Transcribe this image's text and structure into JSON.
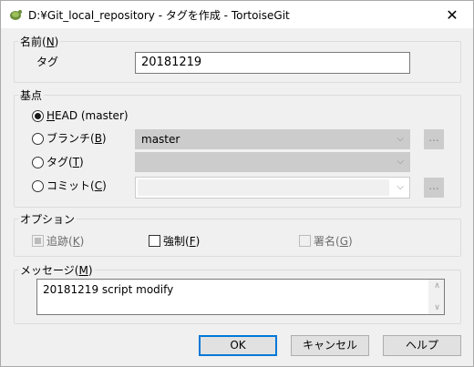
{
  "window": {
    "title": "D:¥Git_local_repository - タグを作成 - TortoiseGit",
    "close_glyph": "✕"
  },
  "name_group": {
    "label": "名前(N)",
    "label_text": "名前(",
    "label_key": "N",
    "label_close": ")",
    "tag_label": "タグ",
    "tag_value": "20181219"
  },
  "base_group": {
    "label_text": "基点",
    "options": {
      "head": {
        "key": "H",
        "rest": "EAD (master)",
        "checked": true
      },
      "branch": {
        "prefix": "ブランチ(",
        "key": "B",
        "suffix": ")",
        "value": "master"
      },
      "tag": {
        "prefix": "タグ(",
        "key": "T",
        "suffix": ")",
        "value": ""
      },
      "commit": {
        "prefix": "コミット(",
        "key": "C",
        "suffix": ")",
        "value": ""
      }
    },
    "browse_label": "...",
    "dropdown_glyph": "⌵"
  },
  "options_group": {
    "label_text": "オプション",
    "track": {
      "prefix": "追跡(",
      "key": "K",
      "suffix": ")"
    },
    "force": {
      "prefix": "強制(",
      "key": "F",
      "suffix": ")"
    },
    "sign": {
      "prefix": "署名(",
      "key": "G",
      "suffix": ")"
    }
  },
  "message_group": {
    "prefix": "メッセージ(",
    "key": "M",
    "suffix": ")",
    "value": "20181219 script modify",
    "scroll_up_glyph": "∧",
    "scroll_down_glyph": "∨"
  },
  "buttons": {
    "ok": "OK",
    "cancel": "キャンセル",
    "help": "ヘルプ"
  }
}
